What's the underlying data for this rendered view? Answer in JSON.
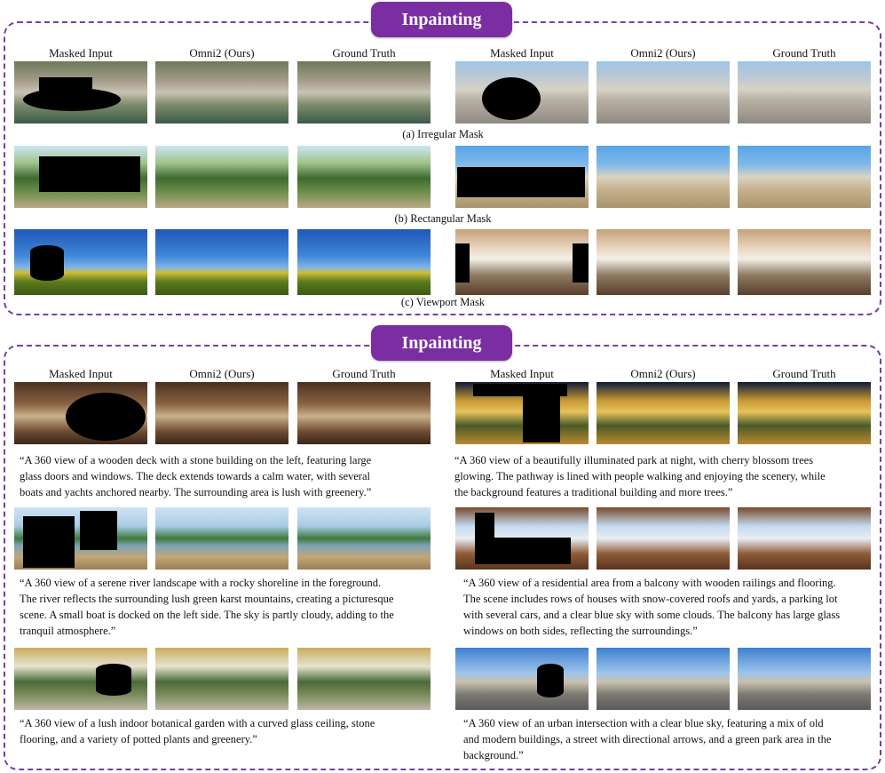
{
  "top": {
    "banner": "Inpainting",
    "col_headers": [
      "Masked Input",
      "Omni2 (Ours)",
      "Ground Truth",
      "Masked Input",
      "Omni2 (Ours)",
      "Ground Truth"
    ],
    "captions": {
      "irregular": "(a) Irregular Mask",
      "rectangular": "(b) Rectangular Mask",
      "viewport": "(c) Viewport Mask"
    }
  },
  "bottom": {
    "banner": "Inpainting",
    "col_headers": [
      "Masked Input",
      "Omni2 (Ours)",
      "Ground Truth",
      "Masked Input",
      "Omni2 (Ours)",
      "Ground Truth"
    ],
    "prompts": {
      "left": [
        [
          "“A 360 view of a wooden deck with a stone building on the left, featuring large",
          "glass doors and windows. The deck extends towards a calm water, with several",
          "boats and yachts anchored nearby. The surrounding area is lush with greenery.”"
        ],
        [
          "“A 360 view of a serene river landscape with a rocky shoreline in the foreground.",
          "The river reflects the surrounding lush green karst mountains, creating a picturesque",
          "scene. A small boat is docked on the left side. The sky is partly cloudy, adding to the",
          "tranquil atmosphere.”"
        ],
        [
          "“A 360 view of a lush indoor botanical garden with a curved glass ceiling, stone",
          "flooring, and a variety of potted plants and greenery.”"
        ]
      ],
      "right": [
        [
          "“A 360 view of a beautifully illuminated park at night, with cherry blossom trees",
          "glowing. The pathway is lined with people walking and enjoying the scenery, while",
          "the background features a traditional building and more trees.”"
        ],
        [
          "“A 360 view of a residential area from a balcony with wooden railings and flooring.",
          "The scene includes rows of houses with snow-covered roofs and yards, a parking lot",
          "with several cars, and a clear blue sky with some clouds. The balcony has large glass",
          "windows on both sides, reflecting the surroundings.”"
        ],
        [
          "“A 360 view of an urban intersection with a clear blue sky, featuring a mix of old",
          "and modern buildings, a street with directional arrows, and a green park area in the",
          "background.”"
        ]
      ]
    }
  }
}
